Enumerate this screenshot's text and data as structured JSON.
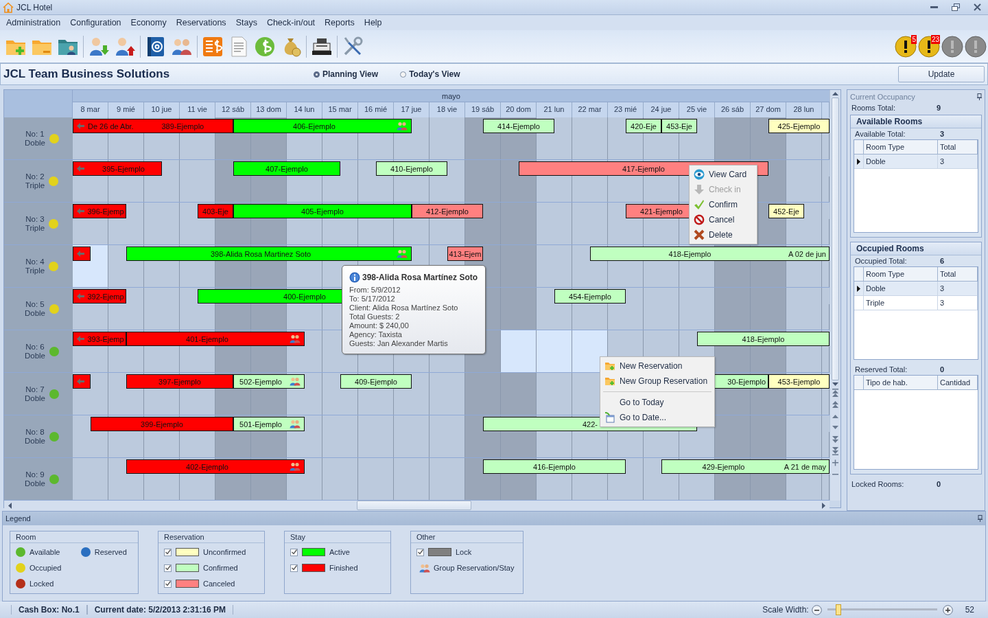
{
  "window": {
    "title": "JCL Hotel"
  },
  "menu": [
    "Administration",
    "Configuration",
    "Economy",
    "Reservations",
    "Stays",
    "Check-in/out",
    "Reports",
    "Help"
  ],
  "alerts": [
    {
      "badge": "5",
      "active": true
    },
    {
      "badge": "23",
      "active": true
    },
    {
      "active": false
    },
    {
      "active": false
    }
  ],
  "company": "JCL Team Business Solutions",
  "views": [
    {
      "label": "Planning View",
      "selected": true
    },
    {
      "label": "Today's View",
      "selected": false
    }
  ],
  "update_button": "Update",
  "planner": {
    "month": "mayo",
    "days": [
      {
        "label": "8 mar",
        "weekend": false
      },
      {
        "label": "9 mié",
        "weekend": false
      },
      {
        "label": "10 jue",
        "weekend": false
      },
      {
        "label": "11 vie",
        "weekend": false
      },
      {
        "label": "12 sáb",
        "weekend": true
      },
      {
        "label": "13 dom",
        "weekend": true
      },
      {
        "label": "14 lun",
        "weekend": false
      },
      {
        "label": "15 mar",
        "weekend": false
      },
      {
        "label": "16 mié",
        "weekend": false
      },
      {
        "label": "17 jue",
        "weekend": false
      },
      {
        "label": "18 vie",
        "weekend": false
      },
      {
        "label": "19 sáb",
        "weekend": true
      },
      {
        "label": "20 dom",
        "weekend": true
      },
      {
        "label": "21 lun",
        "weekend": false
      },
      {
        "label": "22 mar",
        "weekend": false
      },
      {
        "label": "23 mié",
        "weekend": false
      },
      {
        "label": "24 jue",
        "weekend": false
      },
      {
        "label": "25 vie",
        "weekend": false
      },
      {
        "label": "26 sáb",
        "weekend": true
      },
      {
        "label": "27 dom",
        "weekend": true
      },
      {
        "label": "28 lun",
        "weekend": false
      }
    ],
    "rooms": [
      {
        "number": "No: 1",
        "type": "Doble",
        "color": "#e2d21c",
        "bookings": [
          {
            "text": "389-Ejemplo",
            "kind": "finished",
            "continued": true,
            "start_note": "De 26 de Abr.",
            "group": false
          },
          {
            "text": "406-Ejemplo",
            "kind": "active",
            "group": true
          },
          {
            "text": "414-Ejemplo",
            "kind": "confirmed",
            "group": false
          },
          {
            "text": "420-Eje",
            "kind": "confirmed",
            "group": false
          },
          {
            "text": "453-Eje",
            "kind": "confirmed",
            "group": false
          },
          {
            "text": "425-Ejemplo",
            "kind": "unconfirmed",
            "group": false
          }
        ]
      },
      {
        "number": "No: 2",
        "type": "Triple",
        "color": "#e2d21c",
        "bookings": [
          {
            "text": "395-Ejemplo",
            "kind": "finished",
            "continued": true,
            "group": false
          },
          {
            "text": "407-Ejemplo",
            "kind": "active",
            "group": false
          },
          {
            "text": "410-Ejemplo",
            "kind": "confirmed",
            "group": false
          },
          {
            "text": "417-Ejemplo",
            "kind": "canceled",
            "group": false
          }
        ]
      },
      {
        "number": "No: 3",
        "type": "Triple",
        "color": "#e2d21c",
        "bookings": [
          {
            "text": "396-Ejemp",
            "kind": "finished",
            "continued": true,
            "group": false
          },
          {
            "text": "403-Eje",
            "kind": "finished",
            "group": false
          },
          {
            "text": "405-Ejemplo",
            "kind": "active",
            "group": false
          },
          {
            "text": "412-Ejemplo",
            "kind": "canceled",
            "group": false
          },
          {
            "text": "421-Ejemplo",
            "kind": "canceled",
            "group": false
          },
          {
            "text": "452-Eje",
            "kind": "unconfirmed",
            "group": false
          }
        ]
      },
      {
        "number": "No: 4",
        "type": "Triple",
        "color": "#e2d21c",
        "bookings": [
          {
            "kind": "finished",
            "continued": true,
            "group": false
          },
          {
            "text": "398-Alida Rosa Martinez Soto",
            "kind": "active",
            "group": true
          },
          {
            "text": "413-Ejem",
            "kind": "canceled",
            "group": false
          },
          {
            "text": "418-Ejemplo",
            "kind": "confirmed",
            "end_note": "A 02 de jun",
            "group": false
          }
        ]
      },
      {
        "number": "No: 5",
        "type": "Doble",
        "color": "#e2d21c",
        "bookings": [
          {
            "text": "392-Ejemp",
            "kind": "finished",
            "continued": true,
            "group": false
          },
          {
            "text": "400-Ejemplo",
            "kind": "active",
            "group": false
          },
          {
            "text": "454-Ejemplo",
            "kind": "confirmed",
            "group": false
          }
        ]
      },
      {
        "number": "No: 6",
        "type": "Doble",
        "color": "#5cb82e",
        "bookings": [
          {
            "text": "393-Ejemp",
            "kind": "finished",
            "continued": true,
            "group": false
          },
          {
            "text": "401-Ejemplo",
            "kind": "finished",
            "group": true
          },
          {
            "text": "418-Ejemplo",
            "kind": "confirmed",
            "group": false
          }
        ]
      },
      {
        "number": "No: 7",
        "type": "Doble",
        "color": "#5cb82e",
        "bookings": [
          {
            "kind": "finished",
            "continued": true,
            "group": false
          },
          {
            "text": "397-Ejemplo",
            "kind": "finished",
            "group": false
          },
          {
            "text": "502-Ejemplo",
            "kind": "confirmed",
            "group": true
          },
          {
            "text": "409-Ejemplo",
            "kind": "confirmed",
            "group": false
          },
          {
            "text": "30-Ejemplo",
            "kind": "confirmed",
            "group": false
          },
          {
            "text": "453-Ejemplo",
            "kind": "unconfirmed",
            "group": false
          }
        ]
      },
      {
        "number": "No: 8",
        "type": "Doble",
        "color": "#5cb82e",
        "bookings": [
          {
            "text": "399-Ejemplo",
            "kind": "finished",
            "group": false
          },
          {
            "text": "501-Ejemplo",
            "kind": "confirmed",
            "group": true
          },
          {
            "text": "422-",
            "kind": "confirmed",
            "group": false
          }
        ]
      },
      {
        "number": "No: 9",
        "type": "Doble",
        "color": "#5cb82e",
        "bookings": [
          {
            "text": "402-Ejemplo",
            "kind": "finished",
            "group": true
          },
          {
            "text": "416-Ejemplo",
            "kind": "confirmed",
            "group": false
          },
          {
            "text": "429-Ejemplo",
            "kind": "confirmed",
            "end_note": "A 21 de may",
            "group": false
          }
        ]
      }
    ]
  },
  "tooltip": {
    "title": "398-Alida Rosa Martínez Soto",
    "lines": [
      "From: 5/9/2012",
      "To: 5/17/2012",
      "Client: Alida Rosa Martínez Soto",
      "Total Guests: 2",
      "Amount: $ 240,00",
      "Agency: Taxista",
      "Guests: Jan Alexander Martis"
    ]
  },
  "booking_menu": [
    {
      "label": "View Card",
      "disabled": false
    },
    {
      "label": "Check in",
      "disabled": true
    },
    {
      "label": "Confirm",
      "disabled": false
    },
    {
      "label": "Cancel",
      "disabled": false
    },
    {
      "label": "Delete",
      "disabled": false
    }
  ],
  "calendar_menu": [
    [
      "New Reservation",
      "New Group Reservation"
    ],
    [
      "Go to Today",
      "Go to Date..."
    ]
  ],
  "occupancy": {
    "title": "Current Occupancy",
    "rooms_total_label": "Rooms Total:",
    "rooms_total": "9",
    "available": {
      "title": "Available Rooms",
      "total_label": "Available Total:",
      "total": "3",
      "columns": [
        "Room Type",
        "Total"
      ],
      "rows": [
        {
          "cells": [
            "Doble",
            "3"
          ],
          "selected": true
        }
      ]
    },
    "occupied": {
      "title": "Occupied Rooms",
      "total_label": "Occupied Total:",
      "total": "6",
      "columns": [
        "Room Type",
        "Total"
      ],
      "rows": [
        {
          "cells": [
            "Doble",
            "3"
          ],
          "selected": true
        },
        {
          "cells": [
            "Triple",
            "3"
          ],
          "selected": false
        }
      ]
    },
    "reserved": {
      "total_label": "Reserved Total:",
      "total": "0",
      "columns": [
        "Tipo de hab.",
        "Cantidad"
      ]
    },
    "locked_label": "Locked Rooms:",
    "locked": "0"
  },
  "legend": {
    "title": "Legend",
    "groups": [
      {
        "title": "Room",
        "items": [
          {
            "kind": "dot",
            "label": "Available",
            "color": "#5cb82e"
          },
          {
            "kind": "dot",
            "label": "Occupied",
            "color": "#e2d21c"
          },
          {
            "kind": "dot",
            "label": "Locked",
            "color": "#b5301a"
          },
          {
            "kind": "dot",
            "label": "Reserved",
            "color": "#2a6fc0"
          }
        ]
      },
      {
        "title": "Reservation",
        "items": [
          {
            "kind": "swatch",
            "label": "Unconfirmed",
            "color": "#ffffc0",
            "checked": true
          },
          {
            "kind": "swatch",
            "label": "Confirmed",
            "color": "#c0ffc0",
            "checked": true
          },
          {
            "kind": "swatch",
            "label": "Canceled",
            "color": "#ff8080",
            "checked": true
          }
        ]
      },
      {
        "title": "Stay",
        "items": [
          {
            "kind": "swatch",
            "label": "Active",
            "color": "#00ff00",
            "checked": true
          },
          {
            "kind": "swatch",
            "label": "Finished",
            "color": "#ff0000",
            "checked": true
          }
        ]
      },
      {
        "title": "Other",
        "items": [
          {
            "kind": "swatch",
            "label": "Lock",
            "color": "#808080",
            "checked": true
          },
          {
            "kind": "group",
            "label": "Group Reservation/Stay"
          }
        ]
      }
    ]
  },
  "status_bar": {
    "cash_box": "Cash Box: No.1",
    "current_date": "Current date: 5/2/2013 2:31:16 PM",
    "scale_label": "Scale Width:",
    "scale": {
      "level": 0.1
    },
    "scale_value": "52"
  }
}
